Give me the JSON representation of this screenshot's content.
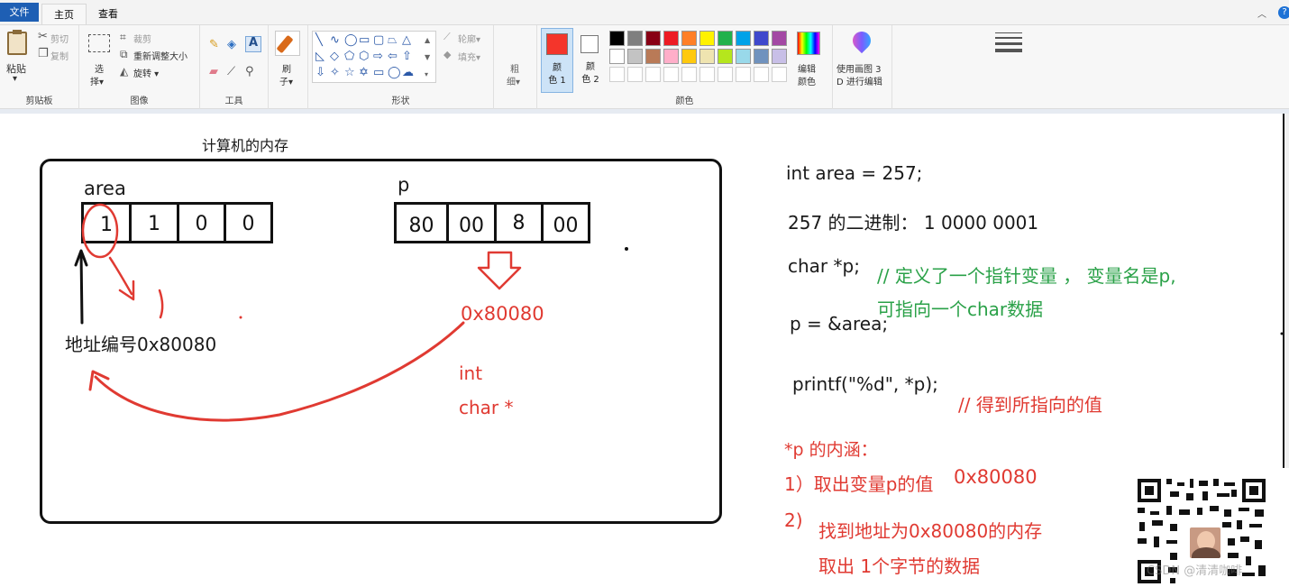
{
  "tabs": {
    "file": "文件",
    "home": "主页",
    "view": "查看"
  },
  "ribbon": {
    "clipboard": {
      "paste": "粘贴",
      "cut": "剪切",
      "copy": "复制",
      "label": "剪贴板"
    },
    "image": {
      "select_1": "选",
      "select_2": "择",
      "crop": "裁剪",
      "resize": "重新调整大小",
      "rotate": "旋转",
      "label": "图像"
    },
    "tools": {
      "label": "工具"
    },
    "brushes": {
      "label_1": "刷",
      "label_2": "子"
    },
    "shapes": {
      "outline": "轮廓",
      "fill": "填充",
      "label": "形状"
    },
    "size": {
      "label_1": "粗",
      "label_2": "细"
    },
    "colors": {
      "color1_1": "颜",
      "color1_2": "色 1",
      "color2_1": "颜",
      "color2_2": "色 2",
      "edit_1": "编辑",
      "edit_2": "颜色",
      "label": "颜色",
      "color1_value": "#f4352b",
      "color2_value": "#ffffff",
      "palette_row1": [
        "#000000",
        "#7f7f7f",
        "#880015",
        "#ed1c24",
        "#ff7f27",
        "#fff200",
        "#22b14c",
        "#00a2e8",
        "#3f48cc",
        "#a349a4"
      ],
      "palette_row2": [
        "#ffffff",
        "#c3c3c3",
        "#b97a57",
        "#ffaec9",
        "#ffc90e",
        "#efe4b0",
        "#b5e61d",
        "#99d9ea",
        "#7092be",
        "#c8bfe7"
      ]
    },
    "paint3d": {
      "line1": "使用画图 3",
      "line2": "D 进行编辑"
    }
  },
  "canvas": {
    "memory_title": "计算机的内存",
    "area_label": "area",
    "area_cells": [
      "1",
      "1",
      "0",
      "0"
    ],
    "p_label": "p",
    "p_cells": [
      "80",
      "00",
      "8",
      "00"
    ],
    "address_label": "地址编号0x80080",
    "p_value": "0x80080",
    "type_int": "int",
    "type_charptr": "char *",
    "code_line1": "int  area = 257;",
    "code_line2": "257 的二进制：  1 0000 0001",
    "code_line3": "char *p;",
    "comment_line3a": "// 定义了一个指针变量 ，  变量名是p,",
    "comment_line3b": "可指向一个char数据",
    "code_line4": "p = &area;",
    "code_line5": "printf(\"%d\",    *p);",
    "comment_line5": "// 得到所指向的值",
    "meaning_title": "*p 的内涵：",
    "step1": "1）取出变量p的值",
    "step1_val": "0x80080",
    "step2_num": "2)",
    "step2_line1": "找到地址为0x80080的内存",
    "step2_line2": "取出   1个字节的数据"
  },
  "watermark": "CSDN @清清咖啡"
}
